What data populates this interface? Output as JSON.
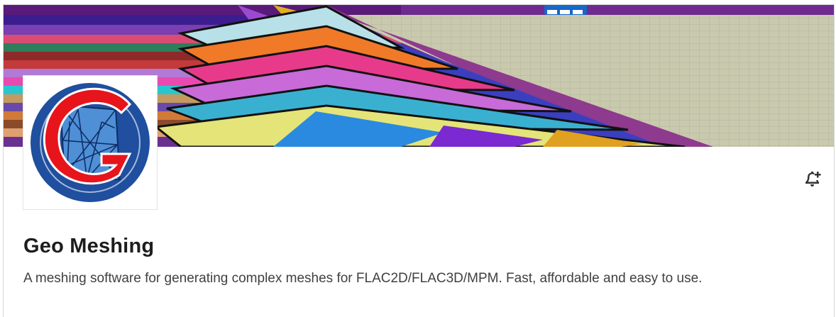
{
  "page": {
    "company_name": "Geo Meshing",
    "tagline": "A meshing software for generating complex meshes for FLAC2D/FLAC3D/MPM. Fast, affordable and easy to use."
  },
  "icons": {
    "logo": "geo-meshing-logo",
    "notification": "bell-plus-icon"
  },
  "colors": {
    "logo_blue": "#1f4f9e",
    "logo_red": "#e8141c",
    "text_primary": "#1d1d1d",
    "text_secondary": "#404040"
  }
}
